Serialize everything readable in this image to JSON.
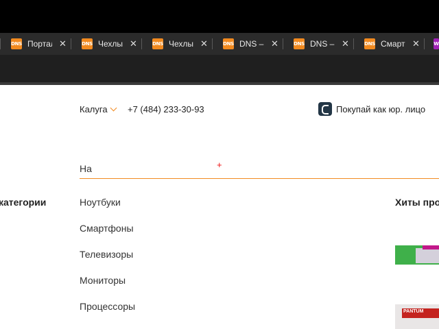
{
  "browser": {
    "tabs": [
      {
        "favicon": "DNS",
        "title": "Портал"
      },
      {
        "favicon": "DNS",
        "title": "Чехлы"
      },
      {
        "favicon": "DNS",
        "title": "Чехлы"
      },
      {
        "favicon": "DNS",
        "title": "DNS –"
      },
      {
        "favicon": "DNS",
        "title": "DNS –"
      },
      {
        "favicon": "DNS",
        "title": "Смартф"
      },
      {
        "favicon": "W",
        "title": ""
      }
    ],
    "close_glyph": "✕"
  },
  "header": {
    "city": "Калуга",
    "phone": "+7 (484) 233-30-93",
    "business_link": "Покупай как юр. лицо"
  },
  "search": {
    "value": "На"
  },
  "categories": {
    "heading": "категории",
    "items": [
      "Ноутбуки",
      "Смартфоны",
      "Телевизоры",
      "Мониторы",
      "Процессоры"
    ]
  },
  "hits": {
    "heading": "Хиты про",
    "product_brand": "PANTUM"
  },
  "colors": {
    "accent": "#f28a1f",
    "tab_bg": "#2b2b2b"
  }
}
